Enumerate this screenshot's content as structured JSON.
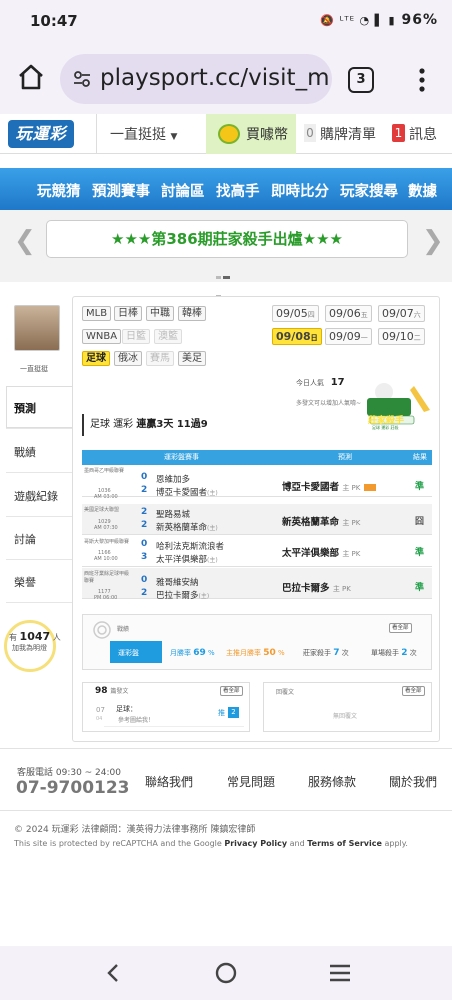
{
  "status_bar": {
    "time": "10:47",
    "battery": "96%",
    "icons": "🔕 ᴸᵀᴱ ◔ ▌ ▮"
  },
  "browser": {
    "url": "playsport.cc/visit_m",
    "tab_count": "3"
  },
  "header": {
    "logo": "玩運彩",
    "user_name": "一直挺挺",
    "coins_label": "買噱幣",
    "cart_count": "0",
    "cart_label": "購牌清單",
    "msg_count": "1",
    "msg_label": "訊息"
  },
  "nav": {
    "items": [
      "玩競猜",
      "預測賽事",
      "討論區",
      "找高手",
      "即時比分",
      "玩家搜尋",
      "數據"
    ]
  },
  "banner": {
    "text": "★★★第386期莊家殺手出爐★★★"
  },
  "sidebar": {
    "avatar_name": "一直挺挺",
    "items": [
      "預測",
      "戰績",
      "遊戲紀錄",
      "討論",
      "榮譽"
    ],
    "followers_count": "1047",
    "followers_unit": "人",
    "followers_sub": "加我為明燈"
  },
  "leagues": {
    "row1": [
      "MLB",
      "日棒",
      "中職",
      "韓棒"
    ],
    "row2": [
      "WNBA",
      "日籃",
      "澳籃"
    ],
    "row3": [
      "足球",
      "俄冰",
      "賽馬",
      "美足"
    ]
  },
  "dates": [
    {
      "d": "09/05",
      "w": "四"
    },
    {
      "d": "09/06",
      "w": "五"
    },
    {
      "d": "09/07",
      "w": "六"
    },
    {
      "d": "09/08",
      "w": "日"
    },
    {
      "d": "09/09",
      "w": "一"
    },
    {
      "d": "09/10",
      "w": "二"
    }
  ],
  "views": {
    "label": "今日人氣",
    "value": "17"
  },
  "add_text": "多發文可以增加人氣唷~",
  "mascot": {
    "title": "莊家殺手",
    "sub": "足球 運彩 莊殺"
  },
  "record_title": {
    "prefix": "足球 運彩",
    "strong": "連贏3天 11過9"
  },
  "table": {
    "headers": [
      "運彩盤賽事",
      "預測",
      "結果"
    ],
    "rows": [
      {
        "league": "墨西哥乙甲級聯賽",
        "id": "1036",
        "time": "AM 03:00",
        "s1": "0",
        "t1": "恩維加多",
        "s2": "2",
        "t2": "博亞卡愛國者",
        "t2tag": "(主)",
        "pred": "博亞卡愛國者",
        "pred_tag": "主 PK",
        "badge": true,
        "res": "準",
        "res_color": "#22a04a"
      },
      {
        "league": "美國足球大聯盟",
        "id": "1029",
        "time": "AM 07:30",
        "s1": "2",
        "t1": "聖路易城",
        "s2": "2",
        "t2": "新英格蘭革命",
        "t2tag": "(主)",
        "pred": "新英格蘭革命",
        "pred_tag": "主 PK",
        "badge": false,
        "res": "囧",
        "res_color": "#555"
      },
      {
        "league": "哥斯大黎加甲級聯賽",
        "id": "1166",
        "time": "AM 10:00",
        "s1": "0",
        "t1": "哈利法克斯流浪者",
        "s2": "3",
        "t2": "太平洋俱樂部",
        "t2tag": "(主)",
        "pred": "太平洋俱樂部",
        "pred_tag": "主 PK",
        "badge": false,
        "res": "準",
        "res_color": "#22a04a"
      },
      {
        "league": "西班牙業餘足球甲級聯賽",
        "id": "1177",
        "time": "PM 06:00",
        "s1": "0",
        "t1": "雅哥維安納",
        "s2": "2",
        "t2": "巴拉卡爾多",
        "t2tag": "(主)",
        "pred": "巴拉卡爾多",
        "pred_tag": "主 PK",
        "badge": false,
        "res": "準",
        "res_color": "#22a04a"
      }
    ]
  },
  "stats": {
    "label": "戰績",
    "see_all": "看全部",
    "arrow_label": "運彩盤",
    "items": [
      {
        "name": "月勝率",
        "value": "69",
        "unit": "%",
        "color": "#1f9be0"
      },
      {
        "name": "主推月勝率",
        "value": "50",
        "unit": "%",
        "color": "#f29a2e"
      },
      {
        "name": "莊家殺手",
        "value": "7",
        "unit": "次",
        "color": "#555"
      },
      {
        "name": "單場殺手",
        "value": "2",
        "unit": "次",
        "color": "#555"
      }
    ]
  },
  "posts": {
    "count": "98",
    "label": "篇發文",
    "see_all": "看全部",
    "date": "07",
    "date_sub": "04",
    "title": "足球：",
    "preview": "參考圖給我！",
    "replies_label": "推",
    "replies": "2"
  },
  "replies_box": {
    "label": "回覆文",
    "see_all": "看全部",
    "empty": "無回覆文"
  },
  "footer": {
    "hours_label": "客服電話 09:30 ~ 24:00",
    "phone": "07-9700123",
    "links": [
      "聯絡我們",
      "常見問題",
      "服務條款",
      "關於我們"
    ],
    "copyright": "© 2024 玩運彩 法律顧問：漢英得力法律事務所 陳鎮宏律師",
    "recaptcha_pre": "This site is protected by reCAPTCHA and the Google",
    "privacy": "Privacy Policy",
    "and": "and",
    "terms": "Terms of Service",
    "apply": "apply."
  }
}
